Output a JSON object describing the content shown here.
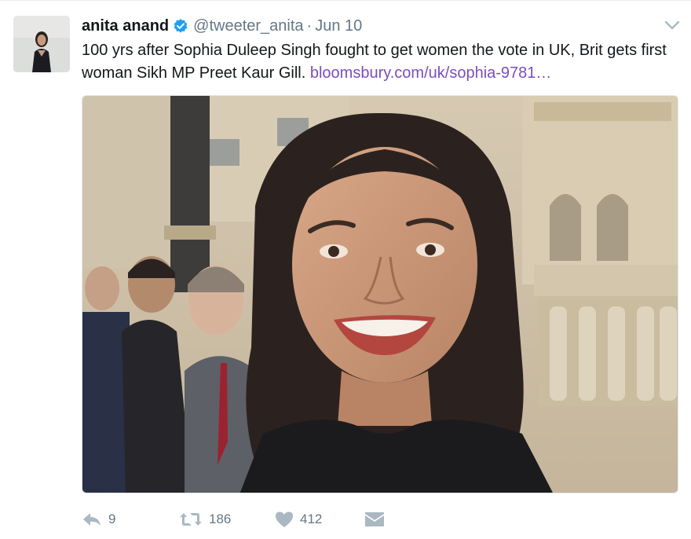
{
  "tweet": {
    "author_name": "anita anand",
    "verified": true,
    "handle": "@tweeter_anita",
    "separator": "·",
    "time": "Jun 10",
    "text": "100 yrs after Sophia Duleep Singh fought to get women the vote in UK, Brit gets first woman Sikh MP Preet Kaur Gill.",
    "link_text": "bloomsbury.com/uk/sophia-9781…"
  },
  "actions": {
    "reply_count": "9",
    "retweet_count": "186",
    "like_count": "412"
  },
  "colors": {
    "link": "#7c4dbd",
    "secondary_text": "#657786",
    "verified_badge": "#1da1f2",
    "icon_gray": "#aab8c2"
  },
  "icons": [
    "verified-badge-icon",
    "caret-down-icon",
    "reply-icon",
    "retweet-icon",
    "like-icon",
    "direct-message-icon"
  ]
}
